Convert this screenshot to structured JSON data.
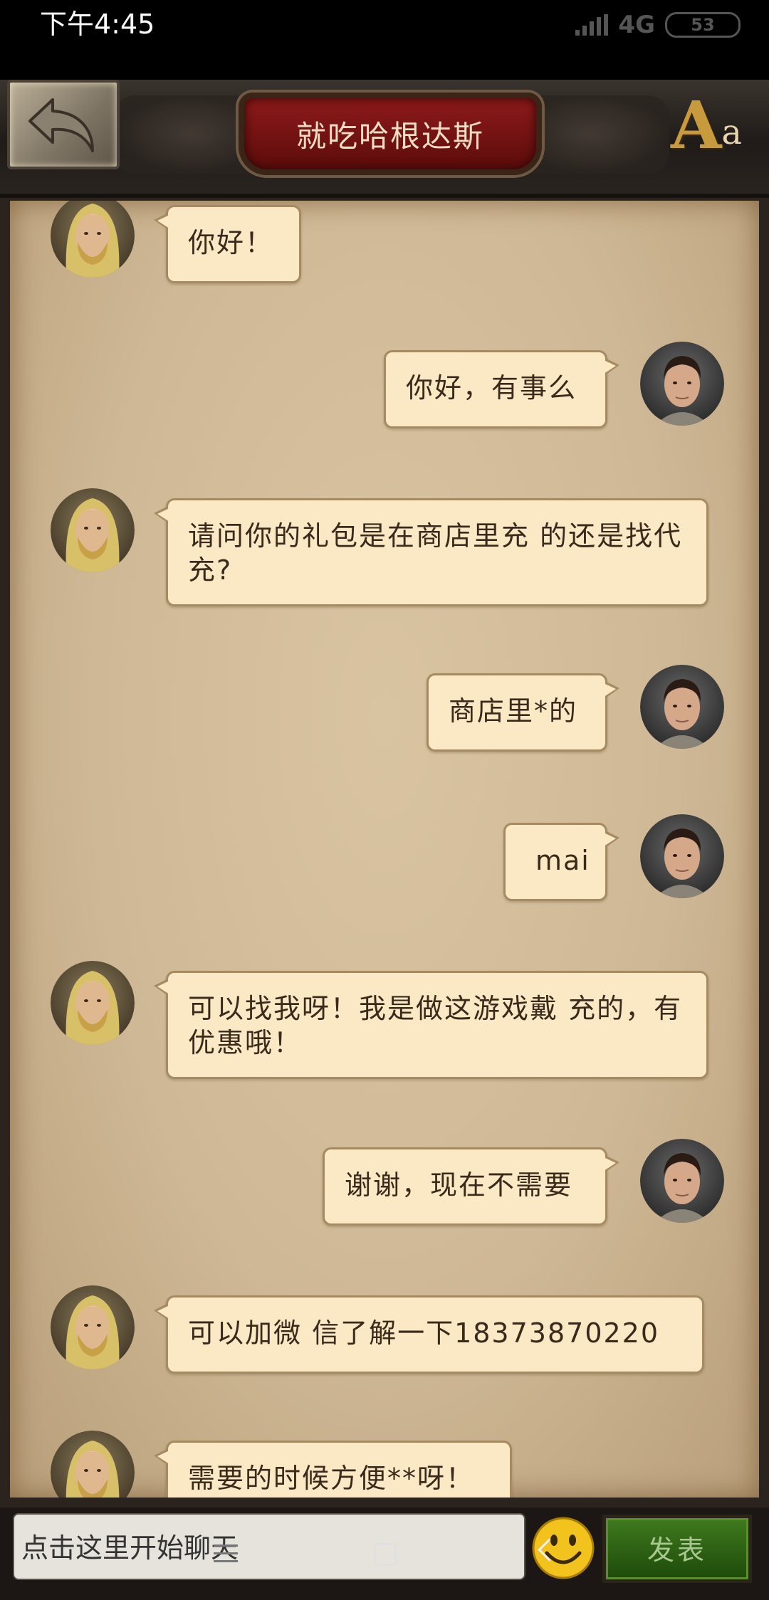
{
  "status_bar": {
    "time": "下午4:45",
    "network": "4G",
    "battery": "53"
  },
  "header": {
    "title": "就吃哈根达斯",
    "font_button_big": "A",
    "font_button_small": "a"
  },
  "messages": [
    {
      "side": "left",
      "text": "你好！"
    },
    {
      "side": "right",
      "text": "你好，有事么"
    },
    {
      "side": "left",
      "text": "请问你的礼包是在商店里充 的还是找代 充?"
    },
    {
      "side": "right",
      "text": "商店里*的"
    },
    {
      "side": "right",
      "text": "mai"
    },
    {
      "side": "left",
      "text": "可以找我呀！我是做这游戏戴 充的，有优惠哦！"
    },
    {
      "side": "right",
      "text": "谢谢，现在不需要"
    },
    {
      "side": "left",
      "text": "可以加微 信了解一下18373870220"
    },
    {
      "side": "left",
      "text": "需要的时候方便**呀！"
    }
  ],
  "input": {
    "placeholder": "点击这里开始聊天",
    "send_label": "发表"
  },
  "colors": {
    "bubble": "#fbe8c4",
    "title_banner": "#8e1a1a",
    "send_button": "#3f7a1e"
  }
}
